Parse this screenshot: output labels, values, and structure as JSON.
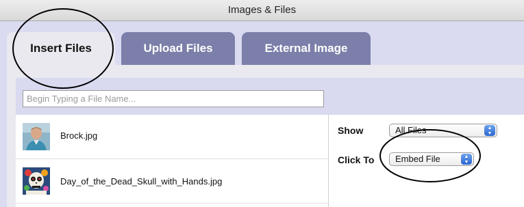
{
  "window": {
    "title": "Images & Files"
  },
  "tabs": [
    {
      "label": "Insert Files",
      "active": true
    },
    {
      "label": "Upload Files",
      "active": false
    },
    {
      "label": "External Image",
      "active": false
    }
  ],
  "search": {
    "placeholder": "Begin Typing a File Name..."
  },
  "files": [
    {
      "name": "Brock.jpg",
      "thumb": "person-photo-thumbnail"
    },
    {
      "name": "Day_of_the_Dead_Skull_with_Hands.jpg",
      "thumb": "skull-artwork-thumbnail"
    }
  ],
  "options": {
    "show_label": "Show",
    "show_value": "All Files",
    "click_to_label": "Click To",
    "click_to_value": "Embed File"
  },
  "colors": {
    "dialog_bg": "#dadbf0",
    "inactive_tab": "#7b7fa9",
    "active_tab": "#e9e9ef",
    "popup_arrows": "#2a66cf",
    "annotation": "#000000"
  }
}
